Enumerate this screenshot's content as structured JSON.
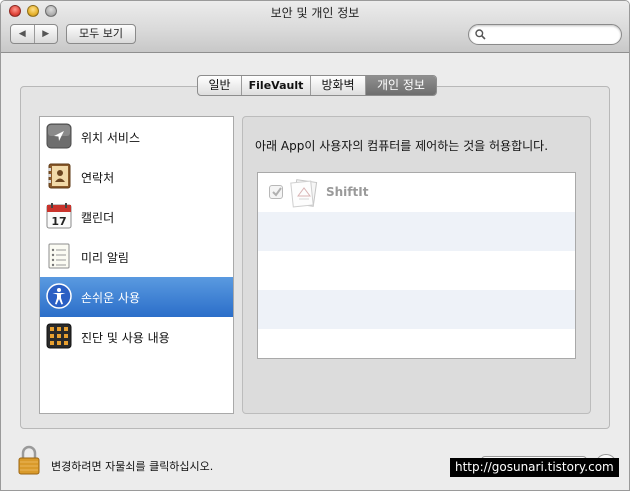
{
  "window": {
    "title": "보안 및 개인 정보"
  },
  "toolbar": {
    "back_icon": "back-arrow-icon",
    "forward_icon": "forward-arrow-icon",
    "show_all_label": "모두 보기",
    "search": {
      "value": "",
      "placeholder": ""
    }
  },
  "tabs": [
    {
      "label": "일반",
      "selected": false
    },
    {
      "label": "FileVault",
      "selected": false
    },
    {
      "label": "방화벽",
      "selected": false
    },
    {
      "label": "개인 정보",
      "selected": true
    }
  ],
  "sidebar": {
    "items": [
      {
        "label": "위치 서비스",
        "icon": "location-arrow-icon",
        "selected": false
      },
      {
        "label": "연락처",
        "icon": "contacts-book-icon",
        "selected": false
      },
      {
        "label": "캘린더",
        "icon": "calendar-icon",
        "icon_text": "17",
        "selected": false
      },
      {
        "label": "미리 알림",
        "icon": "reminders-list-icon",
        "selected": false
      },
      {
        "label": "손쉬운 사용",
        "icon": "accessibility-icon",
        "selected": true
      },
      {
        "label": "진단 및 사용 내용",
        "icon": "diagnostics-grid-icon",
        "selected": false
      }
    ]
  },
  "main": {
    "description": "아래 App이 사용자의 컴퓨터를 제어하는 것을 허용합니다.",
    "apps": [
      {
        "name": "ShiftIt",
        "checked": true,
        "enabled": false,
        "icon": "shiftit-app-icon"
      }
    ]
  },
  "footer": {
    "lock_text": "변경하려면 자물쇠를 클릭하십시오.",
    "watermark": "http://gosunari.tistory.com"
  },
  "colors": {
    "selection_blue": "#2b6ec9",
    "window_bg": "#ececec",
    "selected_tab": "#7a7a7a"
  }
}
